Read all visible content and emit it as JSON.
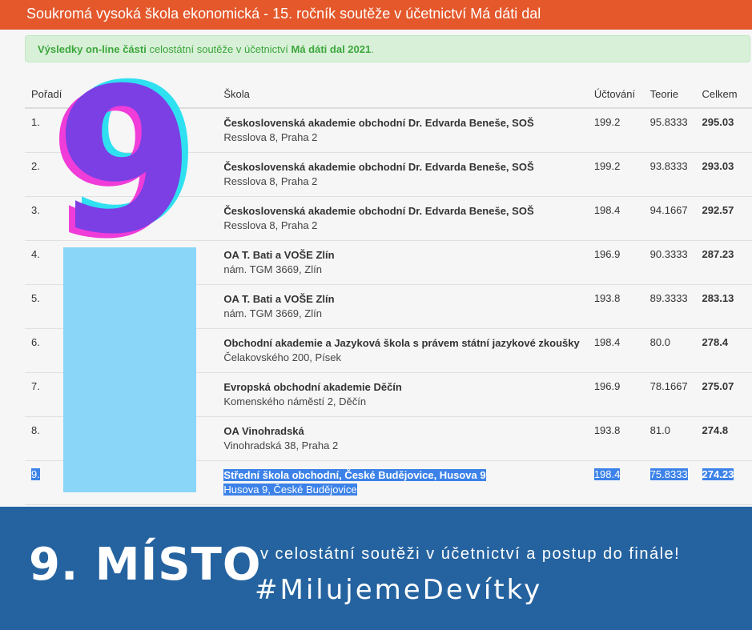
{
  "header": {
    "title": "Soukromá vysoká škola ekonomická - 15. ročník soutěže v účetnictví Má dáti dal"
  },
  "alert": {
    "part1": "Výsledky on-line části",
    "part2": " celostátní soutěže v účetnictví ",
    "part3": "Má dáti dal 2021",
    "part4": "."
  },
  "table": {
    "headers": {
      "rank": "Pořadí",
      "team": "",
      "school": "Škola",
      "uct": "Účtování",
      "teo": "Teorie",
      "tot": "Celkem"
    },
    "rows": [
      {
        "rank": "1.",
        "name": "Československá akademie obchodní Dr. Edvarda Beneše, SOŠ",
        "addr": "Resslova 8, Praha 2",
        "uct": "199.2",
        "teo": "95.8333",
        "tot": "295.03"
      },
      {
        "rank": "2.",
        "name": "Československá akademie obchodní Dr. Edvarda Beneše, SOŠ",
        "addr": "Resslova 8, Praha 2",
        "uct": "199.2",
        "teo": "93.8333",
        "tot": "293.03"
      },
      {
        "rank": "3.",
        "name": "Československá akademie obchodní Dr. Edvarda Beneše, SOŠ",
        "addr": "Resslova 8, Praha 2",
        "uct": "198.4",
        "teo": "94.1667",
        "tot": "292.57"
      },
      {
        "rank": "4.",
        "name": "OA T. Bati a VOŠE Zlín",
        "addr": "nám. TGM 3669, Zlín",
        "uct": "196.9",
        "teo": "90.3333",
        "tot": "287.23"
      },
      {
        "rank": "5.",
        "name": "OA T. Bati a VOŠE Zlín",
        "addr": "nám. TGM 3669, Zlín",
        "uct": "193.8",
        "teo": "89.3333",
        "tot": "283.13"
      },
      {
        "rank": "6.",
        "name": "Obchodní akademie a Jazyková škola s právem státní jazykové zkoušky",
        "addr": "Čelakovského 200, Písek",
        "uct": "198.4",
        "teo": "80.0",
        "tot": "278.4"
      },
      {
        "rank": "7.",
        "name": "Evropská obchodní akademie Děčín",
        "addr": "Komenského náměstí 2, Děčín",
        "uct": "196.9",
        "teo": "78.1667",
        "tot": "275.07"
      },
      {
        "rank": "8.",
        "name": "OA Vinohradská",
        "addr": "Vinohradská 38, Praha 2",
        "uct": "193.8",
        "teo": "81.0",
        "tot": "274.8"
      },
      {
        "rank": "9.",
        "name": "Střední škola obchodní, České Budějovice, Husova 9",
        "addr": "Husova 9, České Budějovice",
        "uct": "198.4",
        "teo": "75.8333",
        "tot": "274.23"
      }
    ]
  },
  "overlay": {
    "big_number": "9",
    "colors": {
      "purple": "#7b3fe4",
      "cyan": "#2fe0f0",
      "magenta": "#f03cd8",
      "blue_block": "#8ad6f8"
    }
  },
  "banner": {
    "place": "9. MÍSTO",
    "sub": "v celostátní soutěži v účetnictví a postup do finále!",
    "tag": "#MilujemeDevítky"
  },
  "colors": {
    "topbar": "#e4582b",
    "banner": "#2563a0",
    "selection": "#3c82e8"
  }
}
